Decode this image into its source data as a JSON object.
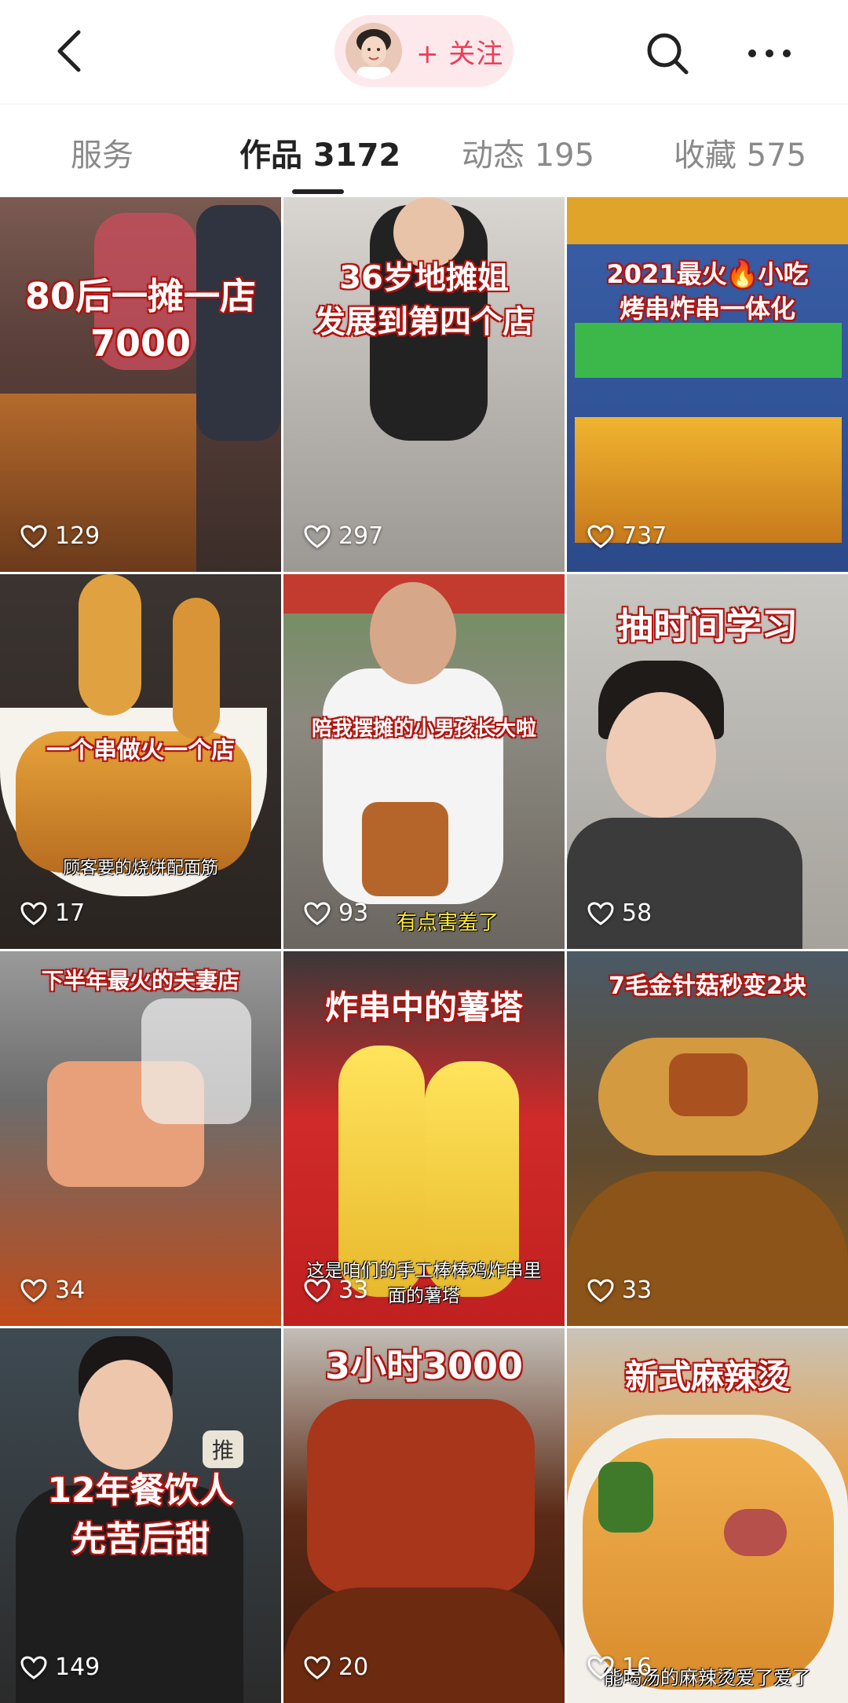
{
  "header": {
    "follow_label": "+ 关注",
    "icons": [
      "back-icon",
      "avatar",
      "search-icon",
      "more-icon"
    ]
  },
  "tabs": [
    {
      "label": "服务",
      "active": false
    },
    {
      "label": "作品 3172",
      "active": true
    },
    {
      "label": "动态 195",
      "active": false
    },
    {
      "label": "收藏 575",
      "active": false
    }
  ],
  "videos": [
    {
      "caption": "80后一摊一店",
      "caption2": "7000",
      "likes": "129"
    },
    {
      "caption": "36岁地摊姐",
      "caption2": "发展到第四个店",
      "likes": "297"
    },
    {
      "caption": "2021最火",
      "caption_icon": "fire-icon",
      "caption_tail": "小吃",
      "caption2": "烤串炸串一体化",
      "likes": "737"
    },
    {
      "caption": "一个串做火一个店",
      "subcaption": "顾客要的烧饼配面筋",
      "likes": "17"
    },
    {
      "caption": "陪我摆摊的小男孩长大啦",
      "subcaption": "有点害羞了",
      "likes": "93"
    },
    {
      "caption": "抽时间学习",
      "likes": "58"
    },
    {
      "caption": "下半年最火的夫妻店",
      "likes": "34"
    },
    {
      "caption": "炸串中的薯塔",
      "subcaption": "这是咱们的手工棒棒鸡炸串里",
      "subcaption2": "面的薯塔",
      "likes": "33"
    },
    {
      "caption": "7毛金针菇秒变2块",
      "likes": "33"
    },
    {
      "caption": "12年餐饮人",
      "caption2": "先苦后甜",
      "badge": "推",
      "likes": "149"
    },
    {
      "caption": "3小时3000",
      "likes": "20"
    },
    {
      "caption": "新式麻辣烫",
      "subcaption": "能喝汤的麻辣烫爱了爱了",
      "likes": "16"
    }
  ],
  "colors": {
    "follow_text": "#f03c58",
    "follow_bg": "#fde9ec",
    "caption_stroke": "#d8211c",
    "tab_active": "#222222",
    "tab_inactive": "#8a8a8a"
  }
}
